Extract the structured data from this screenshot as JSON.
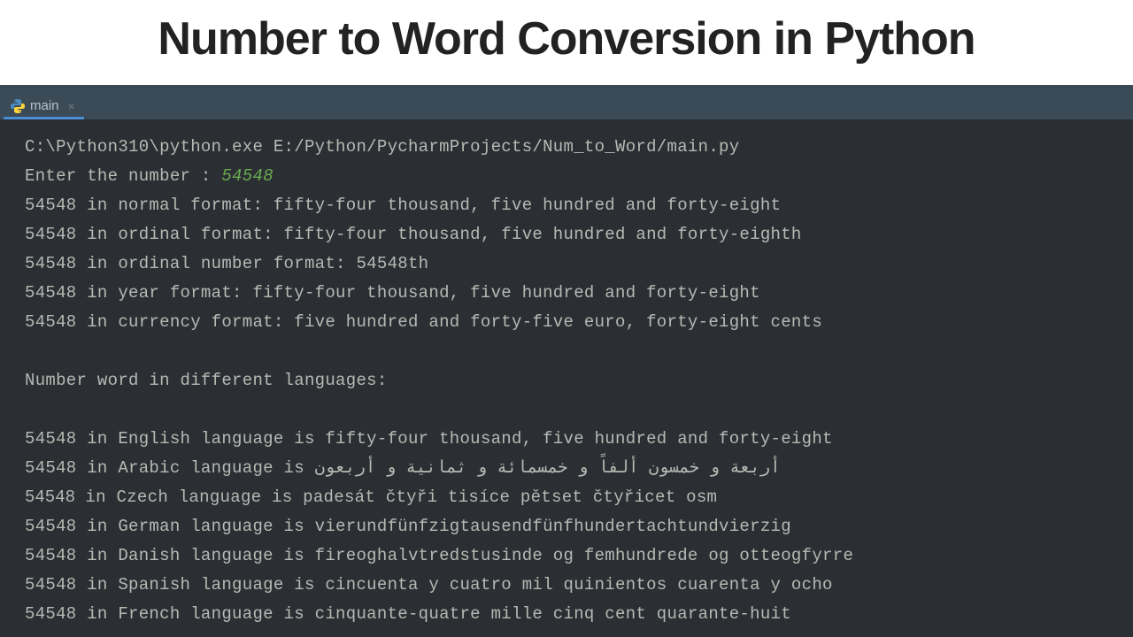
{
  "header": {
    "title": "Number to Word Conversion in Python"
  },
  "tab": {
    "name": "main"
  },
  "console": {
    "command": "C:\\Python310\\python.exe E:/Python/PycharmProjects/Num_to_Word/main.py",
    "prompt": "Enter the number : ",
    "input": "54548",
    "lines_a": [
      "54548 in normal format: fifty-four thousand, five hundred and forty-eight",
      "54548 in ordinal format: fifty-four thousand, five hundred and forty-eighth",
      "54548 in ordinal number format: 54548th",
      "54548 in year format: fifty-four thousand, five hundred and forty-eight",
      "54548 in currency format: five hundred and forty-five euro, forty-eight cents"
    ],
    "section_header": "Number word in different languages:",
    "lines_b": [
      "54548 in English language is fifty-four thousand, five hundred and forty-eight",
      "54548 in Arabic language is أربعة و خمسون ألفاً و خمسمائة و ثمانية و أربعون",
      "54548 in Czech language is padesát čtyři tisíce pětset čtyřicet osm",
      "54548 in German language is vierundfünfzigtausendfünfhundertachtundvierzig",
      "54548 in Danish language is fireoghalvtredstusinde og femhundrede og otteogfyrre",
      "54548 in Spanish language is cincuenta y cuatro mil quinientos cuarenta y ocho",
      "54548 in French language is cinquante-quatre mille cinq cent quarante-huit"
    ]
  }
}
